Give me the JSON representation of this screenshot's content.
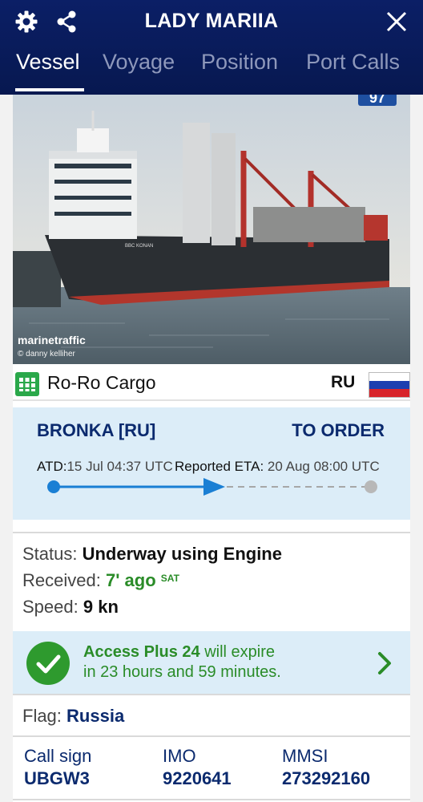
{
  "header": {
    "title": "LADY MARIIA",
    "icons": [
      "gear-icon",
      "share-icon",
      "close-icon"
    ],
    "tabs": [
      {
        "label": "Vessel",
        "active": true
      },
      {
        "label": "Voyage",
        "active": false
      },
      {
        "label": "Position",
        "active": false
      },
      {
        "label": "Port Calls",
        "active": false
      }
    ]
  },
  "photo": {
    "badge": "97",
    "watermark": "marinetraffic",
    "credit": "© danny kelliher",
    "ship_name_on_hull": "BBC KONAN"
  },
  "vessel": {
    "type": "Ro-Ro Cargo",
    "country_code": "RU",
    "flag_colors": [
      "#ffffff",
      "#1c3fb0",
      "#d8242a"
    ]
  },
  "voyage": {
    "from": "BRONKA [RU]",
    "to": "TO ORDER",
    "atd_label": "ATD:",
    "atd_value": "15 Jul 04:37 UTC",
    "atd_overflow": "R",
    "eta_label": "eported ETA:",
    "eta_value": "20 Aug 08:00 UTC",
    "progress": 0.55
  },
  "status": {
    "status_label": "Status:",
    "status_value": "Underway using Engine",
    "received_label": "Received:",
    "received_value": "7' ago",
    "received_source": "SAT",
    "speed_label": "Speed:",
    "speed_value": "9 kn"
  },
  "access": {
    "highlight": "Access Plus 24",
    "text1": " will expire",
    "text2": "in 23 hours and 59 minutes."
  },
  "flag": {
    "label": "Flag:",
    "value": "Russia"
  },
  "identifiers": {
    "callsign_label": "Call sign",
    "callsign_value": "UBGW3",
    "imo_label": "IMO",
    "imo_value": "9220641",
    "mmsi_label": "MMSI",
    "mmsi_value": "273292160"
  },
  "colors": {
    "header_bg": "#0b1f66",
    "accent_blue": "#1a7fd4",
    "green": "#2a8c28",
    "navy_text": "#0b2a6e",
    "panel_bg": "#dcedf8"
  }
}
